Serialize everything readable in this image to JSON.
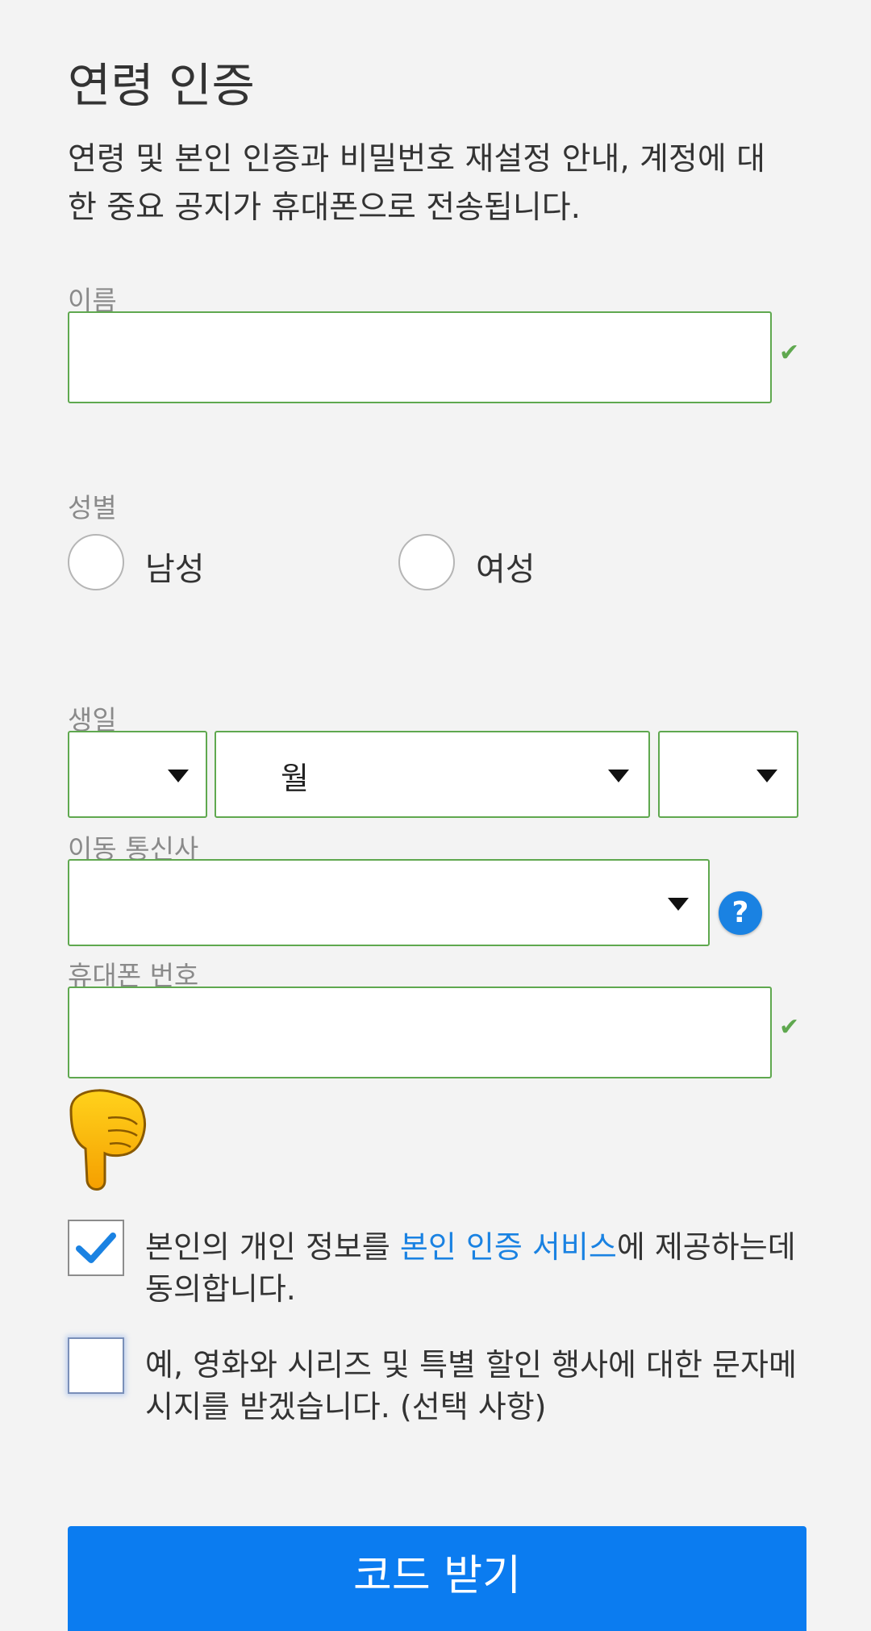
{
  "header": {
    "title": "연령 인증",
    "description": "연령 및 본인 인증과 비밀번호 재설정 안내, 계정에 대한 중요 공지가 휴대폰으로 전송됩니다."
  },
  "name_field": {
    "label": "이름",
    "value": "",
    "valid": true
  },
  "gender": {
    "label": "성별",
    "options": [
      "남성",
      "여성"
    ]
  },
  "birthday": {
    "label": "생일",
    "year": "",
    "month": "월",
    "day": ""
  },
  "carrier": {
    "label": "이동 통신사",
    "value": ""
  },
  "phone": {
    "label": "휴대폰 번호",
    "value": "",
    "valid": true
  },
  "consent": {
    "identity": {
      "checked": true,
      "text_before": "본인의 개인 정보를 ",
      "link": "본인 인증 서비스",
      "text_after": "에 제공하는데 동의합니다."
    },
    "sms": {
      "checked": false,
      "text": "예, 영화와 시리즈 및 특별 할인 행사에 대한 문자메시지를 받겠습니다. (선택 사항)"
    }
  },
  "submit": {
    "label": "코드 받기"
  },
  "icons": {
    "valid": "check-icon",
    "dropdown": "caret-down-icon",
    "help": "question-icon",
    "pointer": "pointing-down-hand-icon"
  },
  "colors": {
    "accent": "#0b7cf0",
    "link": "#1a82e2",
    "valid_border": "#5fa84f"
  }
}
